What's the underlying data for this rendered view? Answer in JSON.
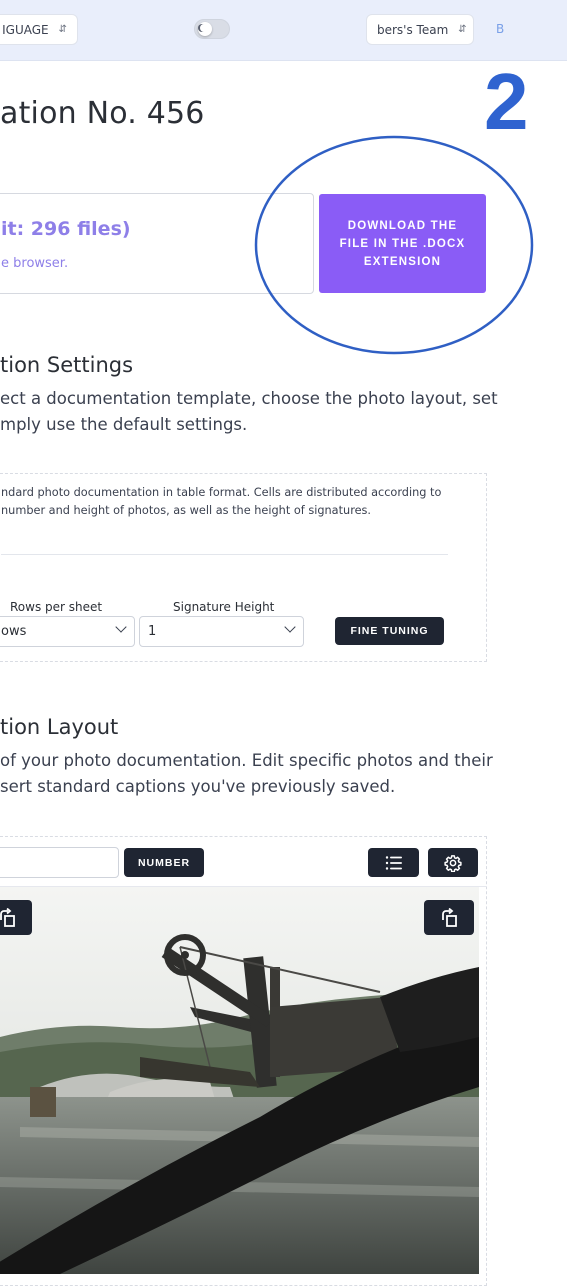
{
  "header": {
    "language_label": "IGUAGE",
    "team_label": "bers's Team",
    "avatar_letter": "B"
  },
  "page_title": "ation No. 456",
  "annotation_number": "2",
  "upload": {
    "limit_text": "it: 296 files)",
    "subtext": "e browser."
  },
  "download_button_label": "DOWNLOAD THE FILE IN THE .DOCX EXTENSION",
  "settings_section": {
    "title": "tion Settings",
    "desc_line1": "ect a documentation template, choose the photo layout, set",
    "desc_line2": "mply use the default settings.",
    "template_desc_line1": "ndard photo documentation in table format. Cells are distributed according to",
    "template_desc_line2": "number and height of photos, as well as the height of signatures.",
    "rows_label": "Rows per sheet",
    "rows_value": "ows",
    "signature_label": "Signature Height",
    "signature_value": "1",
    "fine_tuning_label": "FINE TUNING"
  },
  "layout_section": {
    "title": "tion Layout",
    "desc_line1": "of your photo documentation. Edit specific photos and their",
    "desc_line2": "sert standard captions you've previously saved.",
    "number_button_label": "NUMBER",
    "list_icon": "list-icon",
    "settings_icon": "gear-icon",
    "rotate_icon": "rotate-icon"
  },
  "colors": {
    "accent_purple": "#8a5cf6",
    "annotation_blue": "#2f63d0",
    "dark_button": "#1f2532",
    "header_bg": "#e9eefb"
  }
}
